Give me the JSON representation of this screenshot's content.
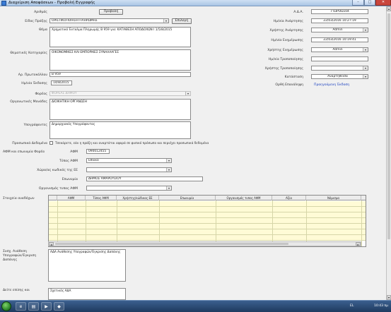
{
  "window": {
    "title": "Διαχείριση Αποφάσεων - Προβολή Εγγραφής",
    "min": "–",
    "max": "□",
    "close": "✕"
  },
  "form": {
    "search_label": "Αριθμός",
    "search_button": "Προβολή",
    "type_label": "Είδος Πράξης",
    "type_value": "ΟΡΙΣΤΙΚΟΠΟΙΗΣΗ ΠΛΗΡΩΜΗΣ",
    "select_button": "Επιλογή",
    "subject_label": "Θέμα",
    "subject_value": "Χρηματικό Ένταλμα Πληρωμής Β 959 για: ΚΑΤΑΘΕΣΗ ΑΠΟΔΟΧΩΝ Ι 1/5/8/2015",
    "category_label": "Θεματικές Κατηγορίες",
    "category_value": "ΟΙΚΟΝΟΜΙΚΕΣ ΚΑΙ ΕΜΠΟΡΙΚΕΣ ΣΥΝΑΛΛΑΓΕΣ",
    "protocol_label": "Αρ. Πρωτοκόλλου",
    "protocol_value": "Β 959",
    "issue_label": "Ημ/νία Έκδοσης",
    "issue_value": "14/8/2015",
    "body_label": "Φορέας",
    "body_value": "ΦΟΡΕΑΣ ΔΗΜΟΥ",
    "org_units_label": "Οργανωτικές Μονάδες",
    "org_units_value": "ΔΙΟΙΚΗΤΙΚΗ ΟΡΓΑΝΩΣΗ",
    "signers_label": "Υπογράφοντες",
    "signers_value": "Δημαρχιακός Υπογράφοντας",
    "public_label": "Προσωπικά Δεδομένα",
    "public_text": "Τσεκάρετε, εάν η πράξη και αναρτάται αφορά σε φυσικό πρόσωπο και περιέχει προσωπικά δεδομένα",
    "afm_section_label": "ΑΦΜ και επωνυμία Φορέα",
    "afm_label": "ΑΦΜ",
    "afm_value": "090012455",
    "afm_type_label": "Τύπος ΑΦΜ",
    "afm_type_value": "Εθνικό",
    "eu_country_label": "Χώρα/ας κωδικός της ΕΕ",
    "eu_country_value": "",
    "name_label": "Επωνυμία",
    "name_value": "ΔΗΜΟΣ ΑΜΑΡΟΥΣΙΟΥ",
    "org_type_label": "Οργανισμός τυπος ΑΦΜ",
    "org_type_value": "",
    "extra_data_label": "Στοιχεία αναδόχων",
    "exec_label": "Συσχ. Ανάθεση Υπογραφών/Έγκριση Δαπάνης",
    "exec_value": "ΑΔΑ Ανάθεσης Υπογραφών/Έγκρισης Δαπάνης",
    "last_label": "Δείτε επίσης και",
    "last_value": "Σχετικός ΑΔΑ"
  },
  "right": {
    "ada_label": "Α.Δ.Α.",
    "ada_value": "7ΤΩΡΟΩ104",
    "created_label": "Ημ/νία Ανάρτησης",
    "created_value": "22/03/2016 10:27:19",
    "user_label": "Χρήστης Ανάρτησης",
    "user_value": "Admin",
    "updated_label": "Ημ/νία Ενημέρωσης",
    "updated_value": "22/03/2016 10:19:41",
    "update_user_label": "Χρήστης Ενημέρωσης",
    "update_user_value": "Admin",
    "mod_date_label": "Ημ/νία Τροποποίησης",
    "mod_date_value": "",
    "mod_user_label": "Χρήστης Τροποποίησης",
    "mod_user_value": "",
    "status_label": "Κατάσταση",
    "status_value": "Αναρτηθείσα",
    "correct_label": "Ορθή Επανάληψη",
    "correct_link": "Προηγούμενη Έκδοση"
  },
  "grid": {
    "headers": [
      "ΑΦΜ",
      "Τύπος ΑΦΜ",
      "Χρήστης/κώδικας ΕΕ",
      "Επωνυμία",
      "Οργανισμός τυπος ΑΦΜ",
      "Αξία",
      "Νόμισμα"
    ]
  },
  "taskbar": {
    "lang": "EL",
    "time": "10:43 πμ"
  }
}
